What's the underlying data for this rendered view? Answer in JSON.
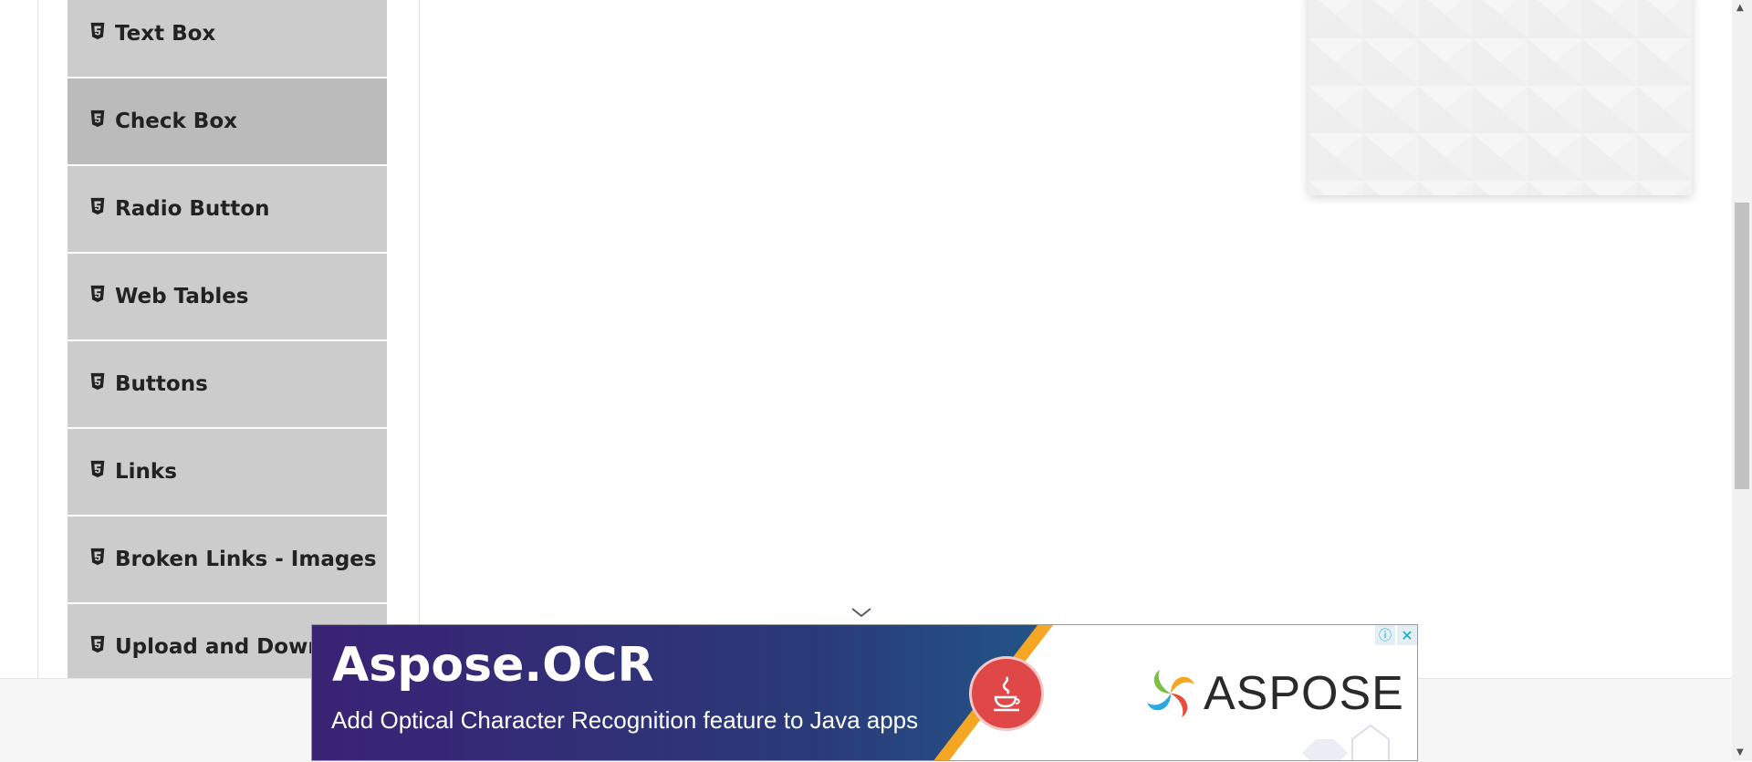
{
  "sidebar": {
    "items": [
      {
        "label": "Text Box",
        "active": false
      },
      {
        "label": "Check Box",
        "active": true
      },
      {
        "label": "Radio Button",
        "active": false
      },
      {
        "label": "Web Tables",
        "active": false
      },
      {
        "label": "Buttons",
        "active": false
      },
      {
        "label": "Links",
        "active": false
      },
      {
        "label": "Broken Links - Images",
        "active": false
      },
      {
        "label": "Upload and Download",
        "active": false
      }
    ],
    "icon": "html5-icon"
  },
  "ad": {
    "title": "Aspose.OCR",
    "subtitle": "Add Optical Character Recognition feature to  Java apps",
    "brand": "ASPOSE",
    "info_icon": "info-icon",
    "close_icon": "close-icon",
    "colors": {
      "gradient_start": "#3a2275",
      "gradient_end": "#1f5f8e",
      "accent": "#f5a623",
      "java_red": "#e04848"
    }
  }
}
